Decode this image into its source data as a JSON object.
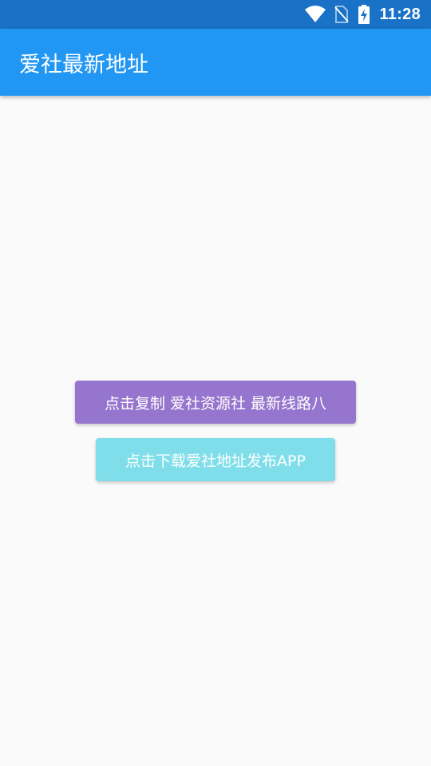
{
  "status_bar": {
    "time": "11:28",
    "icons": [
      "wifi-icon",
      "no-sim-icon",
      "battery-charging-icon"
    ],
    "background": "#1a72c7"
  },
  "app_bar": {
    "title": "爱社最新地址",
    "background": "#2196f3"
  },
  "buttons": {
    "copy_label": "点击复制 爱社资源社 最新线路八",
    "copy_color": "#9575cd",
    "download_label": "点击下载爱社地址发布APP",
    "download_color": "#80deea"
  }
}
